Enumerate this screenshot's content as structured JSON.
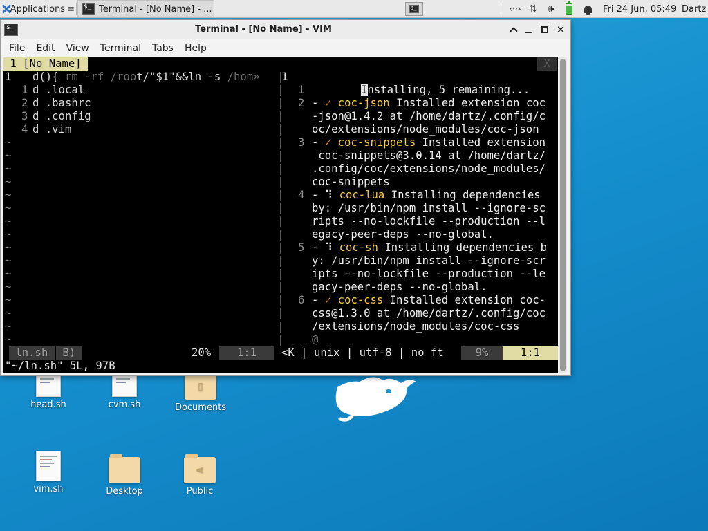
{
  "panel": {
    "applications_label": "Applications",
    "task_label": "Terminal - [No Name] - ...",
    "clock": "Fri 24 Jun, 05:49",
    "user": "Dartz",
    "tray_net": "‹··›",
    "tray_updown": "⇅",
    "tray_volume": "🕪"
  },
  "window": {
    "title": "Terminal - [No Name] - VIM",
    "menus": [
      "File",
      "Edit",
      "View",
      "Terminal",
      "Tabs",
      "Help"
    ]
  },
  "vim": {
    "tab_label": " 1 [No Name] ",
    "tab_close": " X ",
    "left": {
      "line1_num": "1",
      "line1_text": "d(){ rm -rf /root/\"$1\"&&ln -s /hom»",
      "entries": [
        {
          "rel": "1",
          "text": "d .local"
        },
        {
          "rel": "2",
          "text": "d .bashrc"
        },
        {
          "rel": "3",
          "text": "d .config"
        },
        {
          "rel": "4",
          "text": "d .vim"
        }
      ],
      "tilde_count": 16
    },
    "right": {
      "line1_num": "1",
      "line1_cursor": "I",
      "line1_text": "nstalling, 5 remaining...",
      "lines": [
        {
          "num": "1",
          "segments": []
        },
        {
          "num": "2",
          "segments": [
            [
              "- ",
              "white"
            ],
            [
              "✓ ",
              "ok"
            ],
            [
              "coc-json",
              "yellow"
            ],
            [
              " Installed extension coc",
              "white"
            ]
          ]
        },
        {
          "num": "",
          "segments": [
            [
              "-json@1.4.2 at /home/dartz/.config/c",
              "white"
            ]
          ]
        },
        {
          "num": "",
          "segments": [
            [
              "oc/extensions/node_modules/coc-json",
              "white"
            ]
          ]
        },
        {
          "num": "3",
          "segments": [
            [
              "- ",
              "white"
            ],
            [
              "✓ ",
              "ok"
            ],
            [
              "coc-snippets",
              "yellow"
            ],
            [
              " Installed extension",
              "white"
            ]
          ]
        },
        {
          "num": "",
          "segments": [
            [
              " coc-snippets@3.0.14 at /home/dartz/",
              "white"
            ]
          ]
        },
        {
          "num": "",
          "segments": [
            [
              ".config/coc/extensions/node_modules/",
              "white"
            ]
          ]
        },
        {
          "num": "",
          "segments": [
            [
              "coc-snippets",
              "white"
            ]
          ]
        },
        {
          "num": "4",
          "segments": [
            [
              "- ",
              "white"
            ],
            [
              "⠹ ",
              "white"
            ],
            [
              "coc-lua",
              "yellow"
            ],
            [
              " Installing dependencies",
              "white"
            ]
          ]
        },
        {
          "num": "",
          "segments": [
            [
              "by: /usr/bin/npm install --ignore-sc",
              "white"
            ]
          ]
        },
        {
          "num": "",
          "segments": [
            [
              "ripts --no-lockfile --production --l",
              "white"
            ]
          ]
        },
        {
          "num": "",
          "segments": [
            [
              "egacy-peer-deps --no-global.",
              "white"
            ]
          ]
        },
        {
          "num": "5",
          "segments": [
            [
              "- ",
              "white"
            ],
            [
              "⠹ ",
              "white"
            ],
            [
              "coc-sh",
              "yellow"
            ],
            [
              " Installing dependencies b",
              "white"
            ]
          ]
        },
        {
          "num": "",
          "segments": [
            [
              "y: /usr/bin/npm install --ignore-scr",
              "white"
            ]
          ]
        },
        {
          "num": "",
          "segments": [
            [
              "ipts --no-lockfile --production --le",
              "white"
            ]
          ]
        },
        {
          "num": "",
          "segments": [
            [
              "gacy-peer-deps --no-global.",
              "white"
            ]
          ]
        },
        {
          "num": "6",
          "segments": [
            [
              "- ",
              "white"
            ],
            [
              "✓ ",
              "ok"
            ],
            [
              "coc-css",
              "yellow"
            ],
            [
              " Installed extension coc-",
              "white"
            ]
          ]
        },
        {
          "num": "",
          "segments": [
            [
              "css@1.3.0 at /home/dartz/.config/coc",
              "white"
            ]
          ]
        },
        {
          "num": "",
          "segments": [
            [
              "/extensions/node_modules/coc-css",
              "white"
            ]
          ]
        },
        {
          "num": "",
          "segments": [
            [
              "@",
              "muted"
            ]
          ]
        }
      ]
    },
    "status": {
      "left_file": " ln.sh ",
      "left_flag": " B) ",
      "percent_left": "20%",
      "pos_left": " 1:1 ",
      "middle": "<K | unix | utf-8 | no ft",
      "percent_right": " 9% ",
      "pos_right": " 1:1 "
    },
    "message": "\"~/ln.sh\" 5L, 97B"
  },
  "desktop_icons": [
    {
      "label": "head.sh",
      "kind": "doc"
    },
    {
      "label": "cvm.sh",
      "kind": "doc"
    },
    {
      "label": "Documents",
      "kind": "folder-docs"
    },
    {
      "label": "vim.sh",
      "kind": "doc"
    },
    {
      "label": "Desktop",
      "kind": "folder"
    },
    {
      "label": "Public",
      "kind": "folder-share"
    }
  ],
  "colors": {
    "desktop": "#1690cf",
    "vim_tab": "#e1dba4",
    "coc_name": "#efc646",
    "checkmark": "#cf8a1e"
  }
}
